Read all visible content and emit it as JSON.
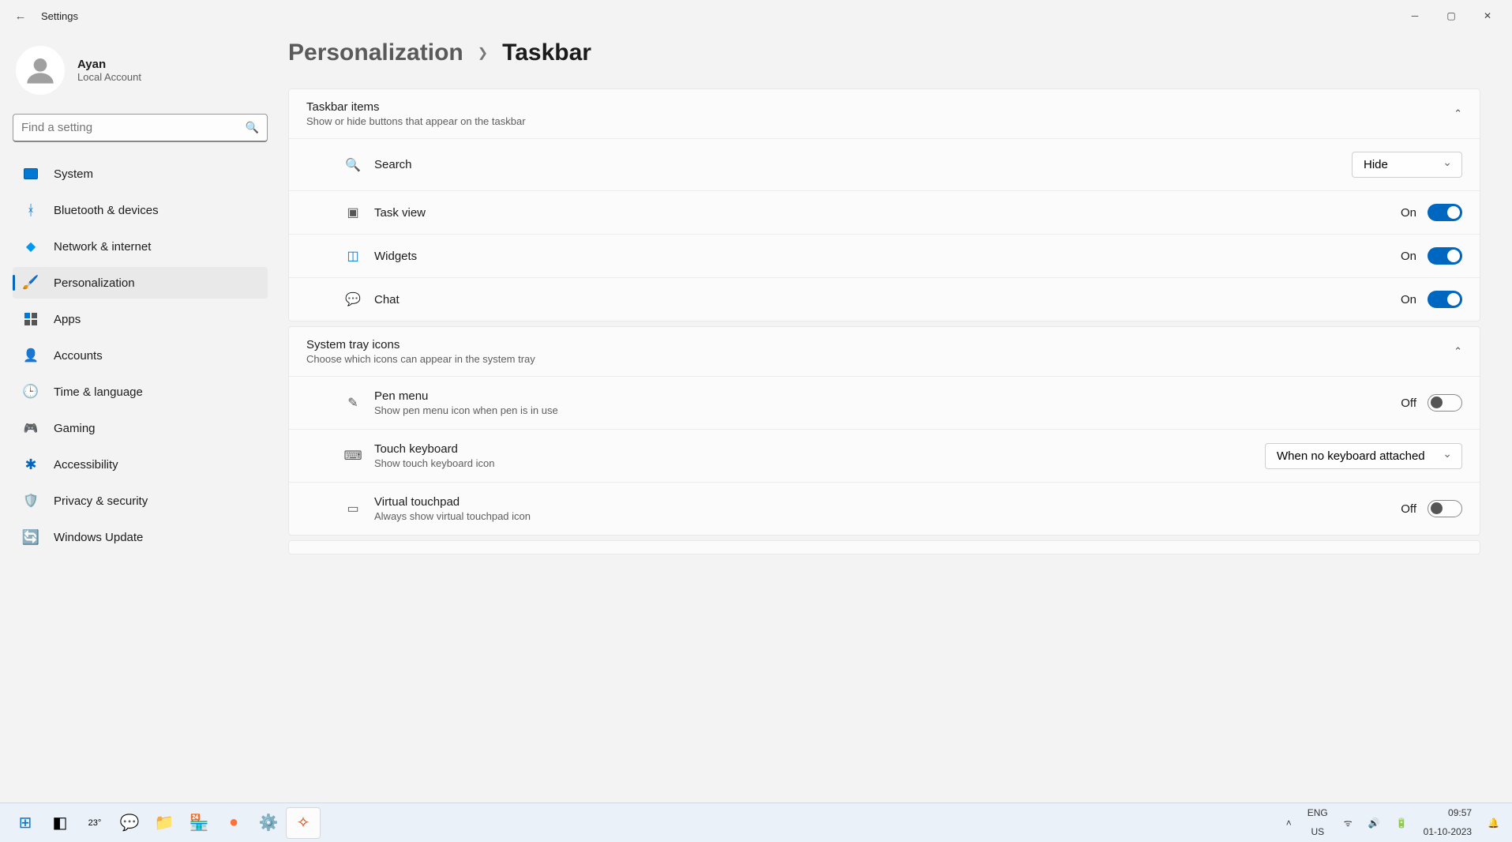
{
  "titlebar": {
    "title": "Settings"
  },
  "profile": {
    "name": "Ayan",
    "sub": "Local Account"
  },
  "search": {
    "placeholder": "Find a setting"
  },
  "nav": [
    {
      "label": "System"
    },
    {
      "label": "Bluetooth & devices"
    },
    {
      "label": "Network & internet"
    },
    {
      "label": "Personalization"
    },
    {
      "label": "Apps"
    },
    {
      "label": "Accounts"
    },
    {
      "label": "Time & language"
    },
    {
      "label": "Gaming"
    },
    {
      "label": "Accessibility"
    },
    {
      "label": "Privacy & security"
    },
    {
      "label": "Windows Update"
    }
  ],
  "breadcrumb": {
    "parent": "Personalization",
    "current": "Taskbar"
  },
  "section1": {
    "title": "Taskbar items",
    "sub": "Show or hide buttons that appear on the taskbar",
    "rows": {
      "search": {
        "label": "Search",
        "value": "Hide"
      },
      "taskview": {
        "label": "Task view",
        "state": "On"
      },
      "widgets": {
        "label": "Widgets",
        "state": "On"
      },
      "chat": {
        "label": "Chat",
        "state": "On"
      }
    }
  },
  "section2": {
    "title": "System tray icons",
    "sub": "Choose which icons can appear in the system tray",
    "rows": {
      "pen": {
        "label": "Pen menu",
        "sub": "Show pen menu icon when pen is in use",
        "state": "Off"
      },
      "touch": {
        "label": "Touch keyboard",
        "sub": "Show touch keyboard icon",
        "value": "When no keyboard attached"
      },
      "vtouchpad": {
        "label": "Virtual touchpad",
        "sub": "Always show virtual touchpad icon",
        "state": "Off"
      }
    }
  },
  "taskbar": {
    "weather": "23°",
    "lang1": "ENG",
    "lang2": "US",
    "time": "09:57",
    "date": "01-10-2023"
  }
}
